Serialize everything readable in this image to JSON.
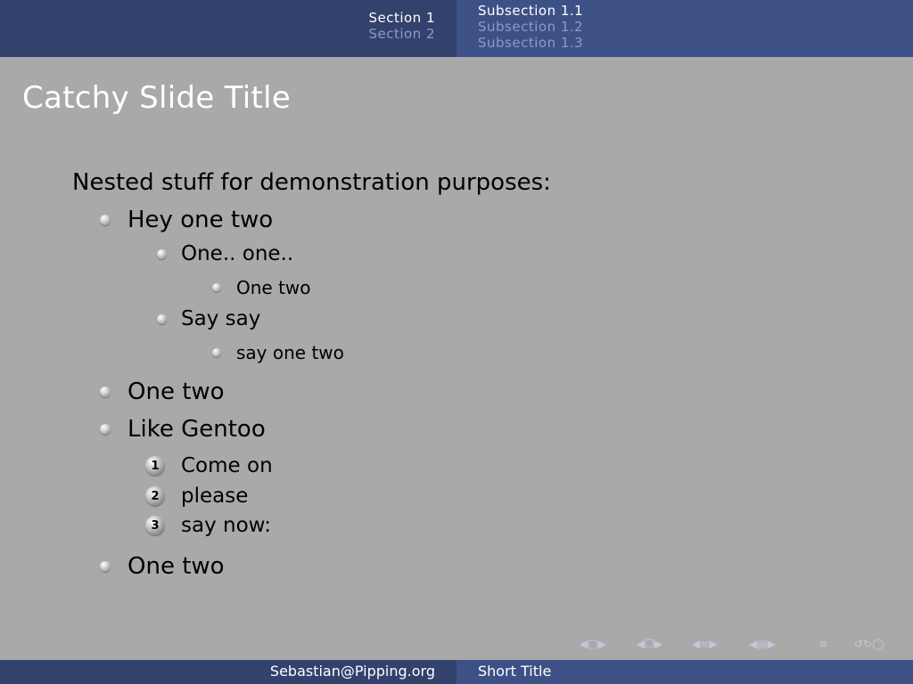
{
  "header": {
    "sections": [
      {
        "label": "Section 1",
        "active": true
      },
      {
        "label": "Section 2",
        "active": false
      }
    ],
    "subsections": [
      {
        "label": "Subsection 1.1",
        "active": true
      },
      {
        "label": "Subsection 1.2",
        "active": false
      },
      {
        "label": "Subsection 1.3",
        "active": false
      }
    ]
  },
  "slide": {
    "title": "Catchy Slide Title",
    "intro": "Nested stuff for demonstration purposes:",
    "items": {
      "a": "Hey one two",
      "a1": "One.. one..",
      "a1i": "One two",
      "a2": "Say say",
      "a2i": "say one two",
      "b": "One two",
      "c": "Like Gentoo",
      "c1": "Come on",
      "c2": "please",
      "c3": "say now:",
      "d": "One two"
    },
    "enum_numbers": [
      "1",
      "2",
      "3"
    ]
  },
  "nav_icons": [
    "slide-nav-icon",
    "frame-nav-icon",
    "subsection-nav-icon",
    "section-nav-icon",
    "appendix-nav-icon",
    "back-forward-search-icon"
  ],
  "footer": {
    "author": "Sebastian@Pipping.org",
    "short_title": "Short Title"
  },
  "colors": {
    "background": "#a9a9a9",
    "header_dark": "#33426c",
    "header_light": "#3e5187",
    "title": "#ffffff"
  }
}
